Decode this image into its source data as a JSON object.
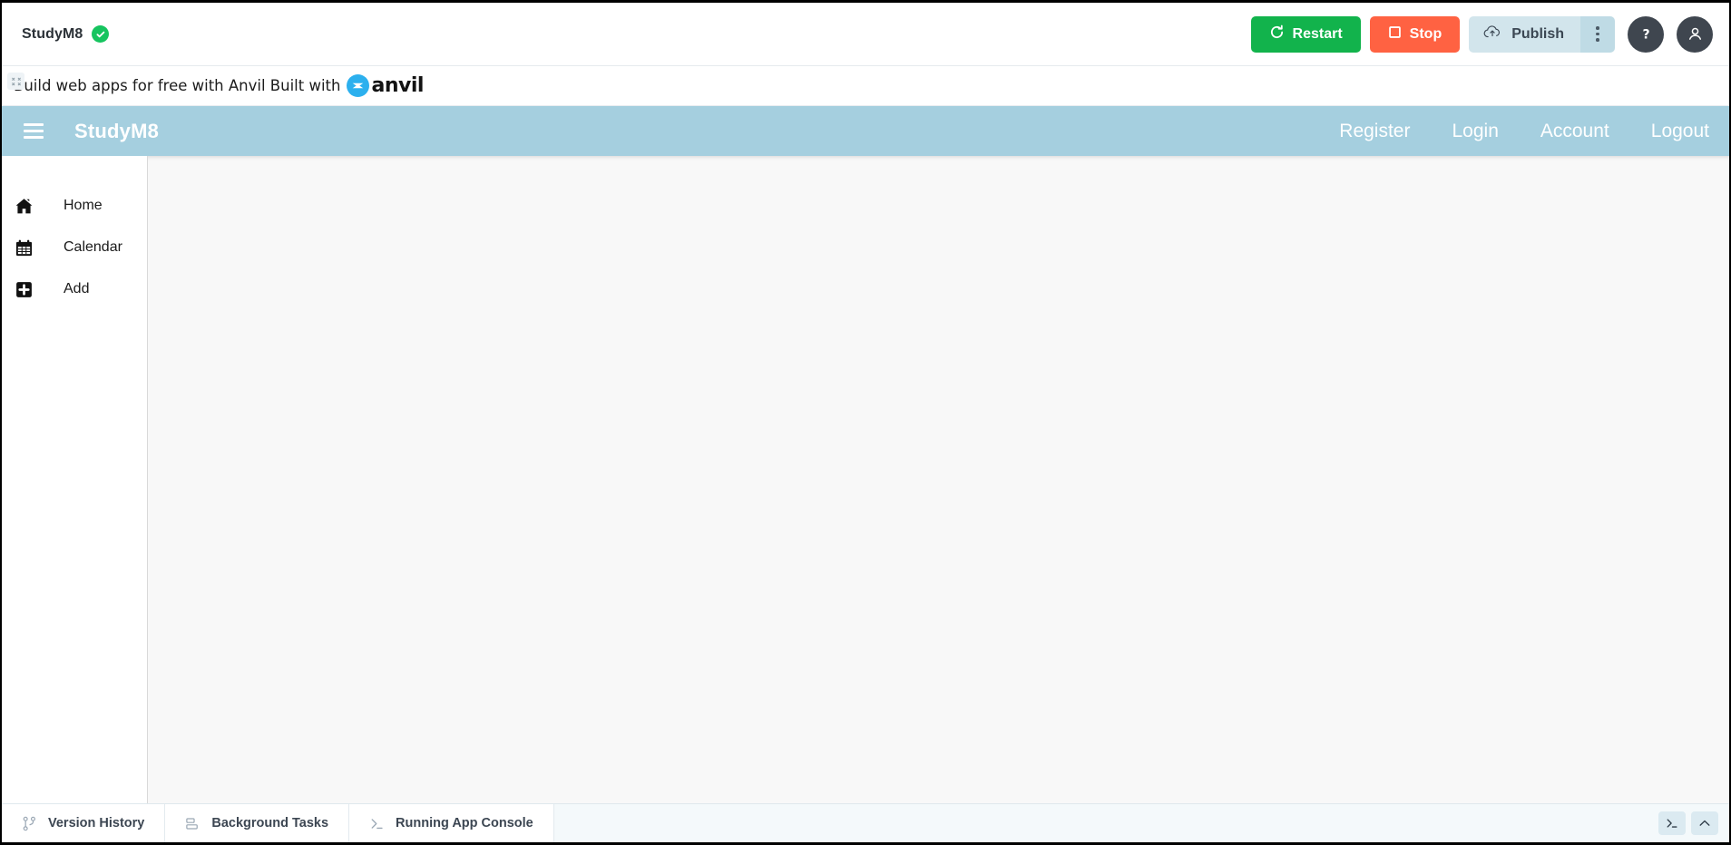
{
  "ide": {
    "app_name": "StudyM8",
    "status_icon": "check-circle-icon",
    "buttons": {
      "restart": "Restart",
      "stop": "Stop",
      "publish": "Publish",
      "publish_more_icon": "kebab-menu-icon",
      "help_icon": "question-mark-icon",
      "profile_icon": "user-avatar-icon"
    },
    "colors": {
      "restart": "#12b34c",
      "stop": "#ff6242",
      "publish": "#d2e5ec",
      "status": "#16c45f",
      "navbar": "#a5cfdf",
      "circle_button": "#3f464f"
    }
  },
  "promo": {
    "broken_image_icon": "broken-image-icon",
    "text": "Build web apps for free with Anvil Built with",
    "logo_word": "anvil",
    "logo_icon": "anvil-logo-icon"
  },
  "navbar": {
    "menu_icon": "hamburger-menu-icon",
    "brand": "StudyM8",
    "links": [
      {
        "label": "Register"
      },
      {
        "label": "Login"
      },
      {
        "label": "Account"
      },
      {
        "label": "Logout"
      }
    ]
  },
  "sidebar": {
    "items": [
      {
        "label": "Home",
        "icon": "home-icon"
      },
      {
        "label": "Calendar",
        "icon": "calendar-icon"
      },
      {
        "label": "Add",
        "icon": "plus-square-icon"
      }
    ]
  },
  "main": {
    "content": ""
  },
  "bottombar": {
    "tabs": [
      {
        "label": "Version History",
        "icon": "branch-icon"
      },
      {
        "label": "Background Tasks",
        "icon": "tasks-icon"
      },
      {
        "label": "Running App Console",
        "icon": "terminal-icon"
      }
    ],
    "right_buttons": [
      {
        "icon": "terminal-prompt-icon"
      },
      {
        "icon": "chevron-up-icon"
      }
    ]
  }
}
